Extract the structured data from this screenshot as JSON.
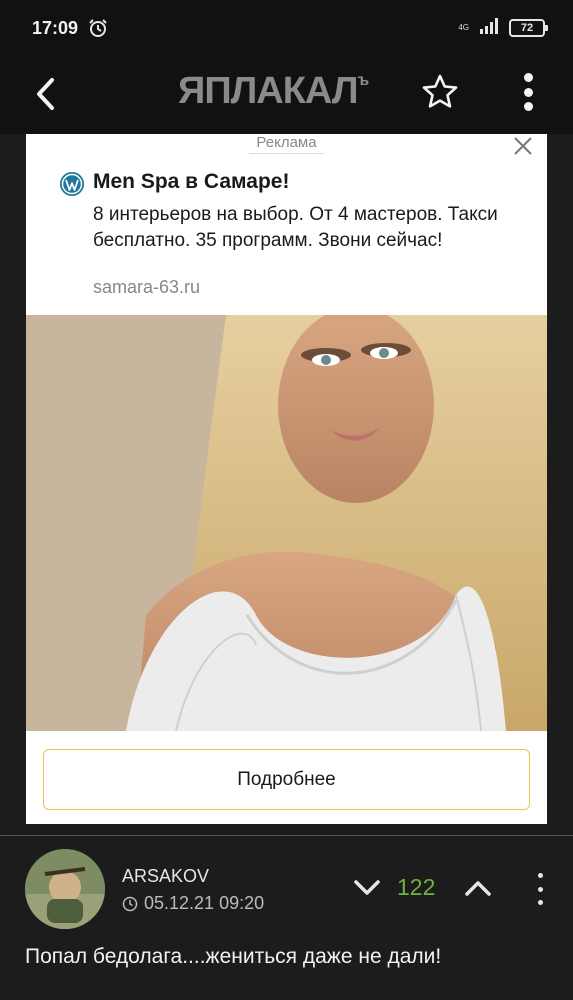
{
  "status_bar": {
    "time": "17:09",
    "network": "4G",
    "battery": "72"
  },
  "header": {
    "logo": "ЯПЛАКАЛ",
    "logo_suffix": "ъ"
  },
  "ad": {
    "label": "Реклама",
    "title": "Men Spa в Самаре!",
    "description": "8 интерьеров на выбор. От 4 мастеров. Такси бесплатно. 35 программ. Звони сейчас!",
    "url": "samara-63.ru",
    "button_label": "Подробнее"
  },
  "comment": {
    "username": "ARSAKOV",
    "date": "05.12.21 09:20",
    "votes": "122",
    "text": "Попал бедолага....жениться даже не дали!"
  },
  "colors": {
    "background": "#1c1c1c",
    "header": "#111111",
    "vote_positive": "#6db33f",
    "button_border": "#e5c84b"
  }
}
